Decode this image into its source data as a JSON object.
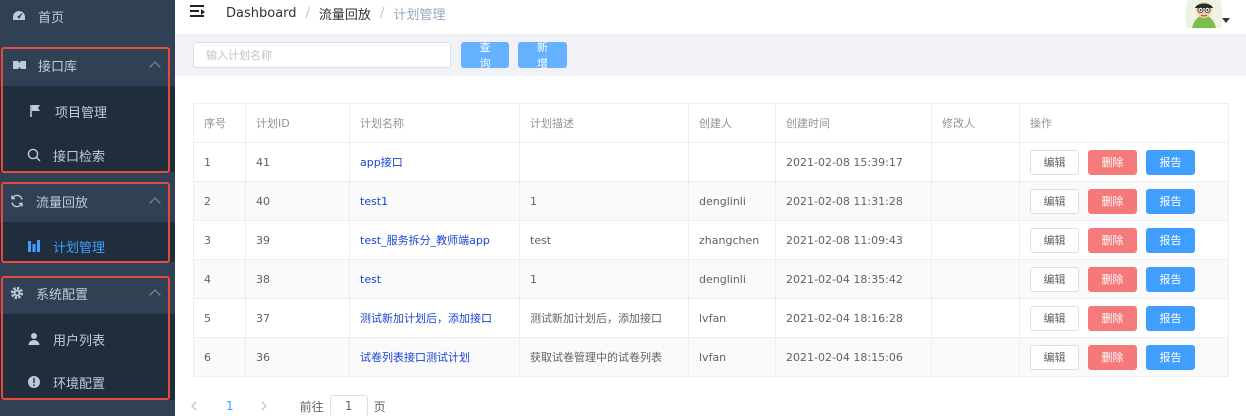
{
  "sidebar": {
    "home": "首页",
    "groups": [
      {
        "label": "接口库",
        "items": [
          "项目管理",
          "接口检索"
        ]
      },
      {
        "label": "流量回放",
        "items": [
          "计划管理"
        ]
      },
      {
        "label": "系统配置",
        "items": [
          "用户列表",
          "环境配置"
        ]
      }
    ],
    "colors": {
      "bg": "#304156",
      "submenu_bg": "#1f2d3d",
      "text": "#bfcbd9",
      "active": "#409eff",
      "highlight_box": "#e64a3c"
    }
  },
  "header": {
    "breadcrumb": [
      "Dashboard",
      "流量回放",
      "计划管理"
    ]
  },
  "filter": {
    "placeholder": "输入计划名称",
    "query_label": "查询",
    "add_label": "新增"
  },
  "table": {
    "columns": [
      "序号",
      "计划ID",
      "计划名称",
      "计划描述",
      "创建人",
      "创建时间",
      "修改人",
      "操作"
    ],
    "rows": [
      {
        "no": "1",
        "id": "41",
        "name": "app接口",
        "desc": "",
        "creator": "",
        "created": "2021-02-08 15:39:17",
        "modifier": ""
      },
      {
        "no": "2",
        "id": "40",
        "name": "test1",
        "desc": "1",
        "creator": "denglinli",
        "created": "2021-02-08 11:31:28",
        "modifier": ""
      },
      {
        "no": "3",
        "id": "39",
        "name": "test_服务拆分_教师端app",
        "desc": "test",
        "creator": "zhangchen",
        "created": "2021-02-08 11:09:43",
        "modifier": ""
      },
      {
        "no": "4",
        "id": "38",
        "name": "test",
        "desc": "1",
        "creator": "denglinli",
        "created": "2021-02-04 18:35:42",
        "modifier": ""
      },
      {
        "no": "5",
        "id": "37",
        "name": "测试新加计划后，添加接口",
        "desc": "测试新加计划后，添加接口",
        "creator": "lvfan",
        "created": "2021-02-04 18:16:28",
        "modifier": ""
      },
      {
        "no": "6",
        "id": "36",
        "name": "试卷列表接口测试计划",
        "desc": "获取试卷管理中的试卷列表",
        "creator": "lvfan",
        "created": "2021-02-04 18:15:06",
        "modifier": ""
      }
    ],
    "actions": {
      "edit": "编辑",
      "delete": "删除",
      "report": "报告"
    },
    "colors": {
      "link": "#1a44d6",
      "delete": "#f56c6c",
      "report": "#409eff"
    }
  },
  "pagination": {
    "current_page": "1",
    "goto_prefix": "前往",
    "goto_value": "1",
    "goto_suffix": "页"
  }
}
